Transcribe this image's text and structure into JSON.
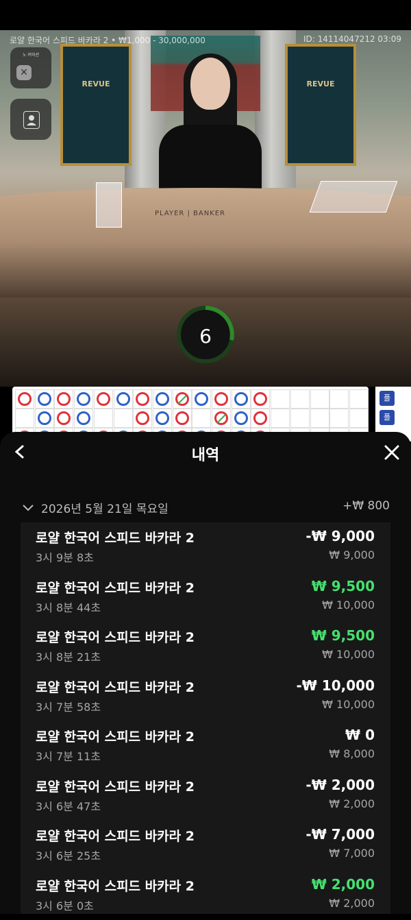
{
  "stream": {
    "title": "로얄 한국어 스피드 바카라 2 • ₩1,000 - 30,000,000",
    "id_text": "ID: 14114047212 03:09",
    "panel_text": "REVUE",
    "table_label": "PLAYER | BANKER",
    "no_commission_label": "노 커미션",
    "timer": "6"
  },
  "roadmap": {
    "row1": [
      "B",
      "P",
      "B",
      "P",
      "B",
      "P",
      "B",
      "P",
      "BG",
      "P",
      "B",
      "P",
      "B",
      "",
      "",
      "",
      "",
      ""
    ],
    "row2": [
      "",
      "P",
      "B",
      "P",
      "",
      "",
      "B",
      "P",
      "B",
      "",
      "BG",
      "P",
      "B",
      "",
      "",
      "",
      "",
      ""
    ],
    "side_labels": [
      "플",
      "플"
    ]
  },
  "sheet": {
    "title": "내역",
    "date": "2026년 5월 21일 목요일",
    "date_total": "+₩ 800",
    "items": [
      {
        "name": "로얄 한국어 스피드 바카라 2",
        "time": "3시 9분 8초",
        "amount": "-₩ 9,000",
        "bet": "₩ 9,000",
        "win": false
      },
      {
        "name": "로얄 한국어 스피드 바카라 2",
        "time": "3시 8분 44초",
        "amount": "₩ 9,500",
        "bet": "₩ 10,000",
        "win": true
      },
      {
        "name": "로얄 한국어 스피드 바카라 2",
        "time": "3시 8분 21초",
        "amount": "₩ 9,500",
        "bet": "₩ 10,000",
        "win": true
      },
      {
        "name": "로얄 한국어 스피드 바카라 2",
        "time": "3시 7분 58초",
        "amount": "-₩ 10,000",
        "bet": "₩ 10,000",
        "win": false
      },
      {
        "name": "로얄 한국어 스피드 바카라 2",
        "time": "3시 7분 11초",
        "amount": "₩ 0",
        "bet": "₩ 8,000",
        "win": false
      },
      {
        "name": "로얄 한국어 스피드 바카라 2",
        "time": "3시 6분 47초",
        "amount": "-₩ 2,000",
        "bet": "₩ 2,000",
        "win": false
      },
      {
        "name": "로얄 한국어 스피드 바카라 2",
        "time": "3시 6분 25초",
        "amount": "-₩ 7,000",
        "bet": "₩ 7,000",
        "win": false
      },
      {
        "name": "로얄 한국어 스피드 바카라 2",
        "time": "3시 6분 0초",
        "amount": "₩ 2,000",
        "bet": "₩ 2,000",
        "win": true
      }
    ]
  },
  "colors": {
    "win": "#45e06e",
    "loss": "#ffffff",
    "banker": "#e0323c",
    "player": "#2d62c8"
  },
  "icons": {
    "back": "chevron-left-icon",
    "close": "close-icon",
    "expand": "chevron-down-icon"
  }
}
